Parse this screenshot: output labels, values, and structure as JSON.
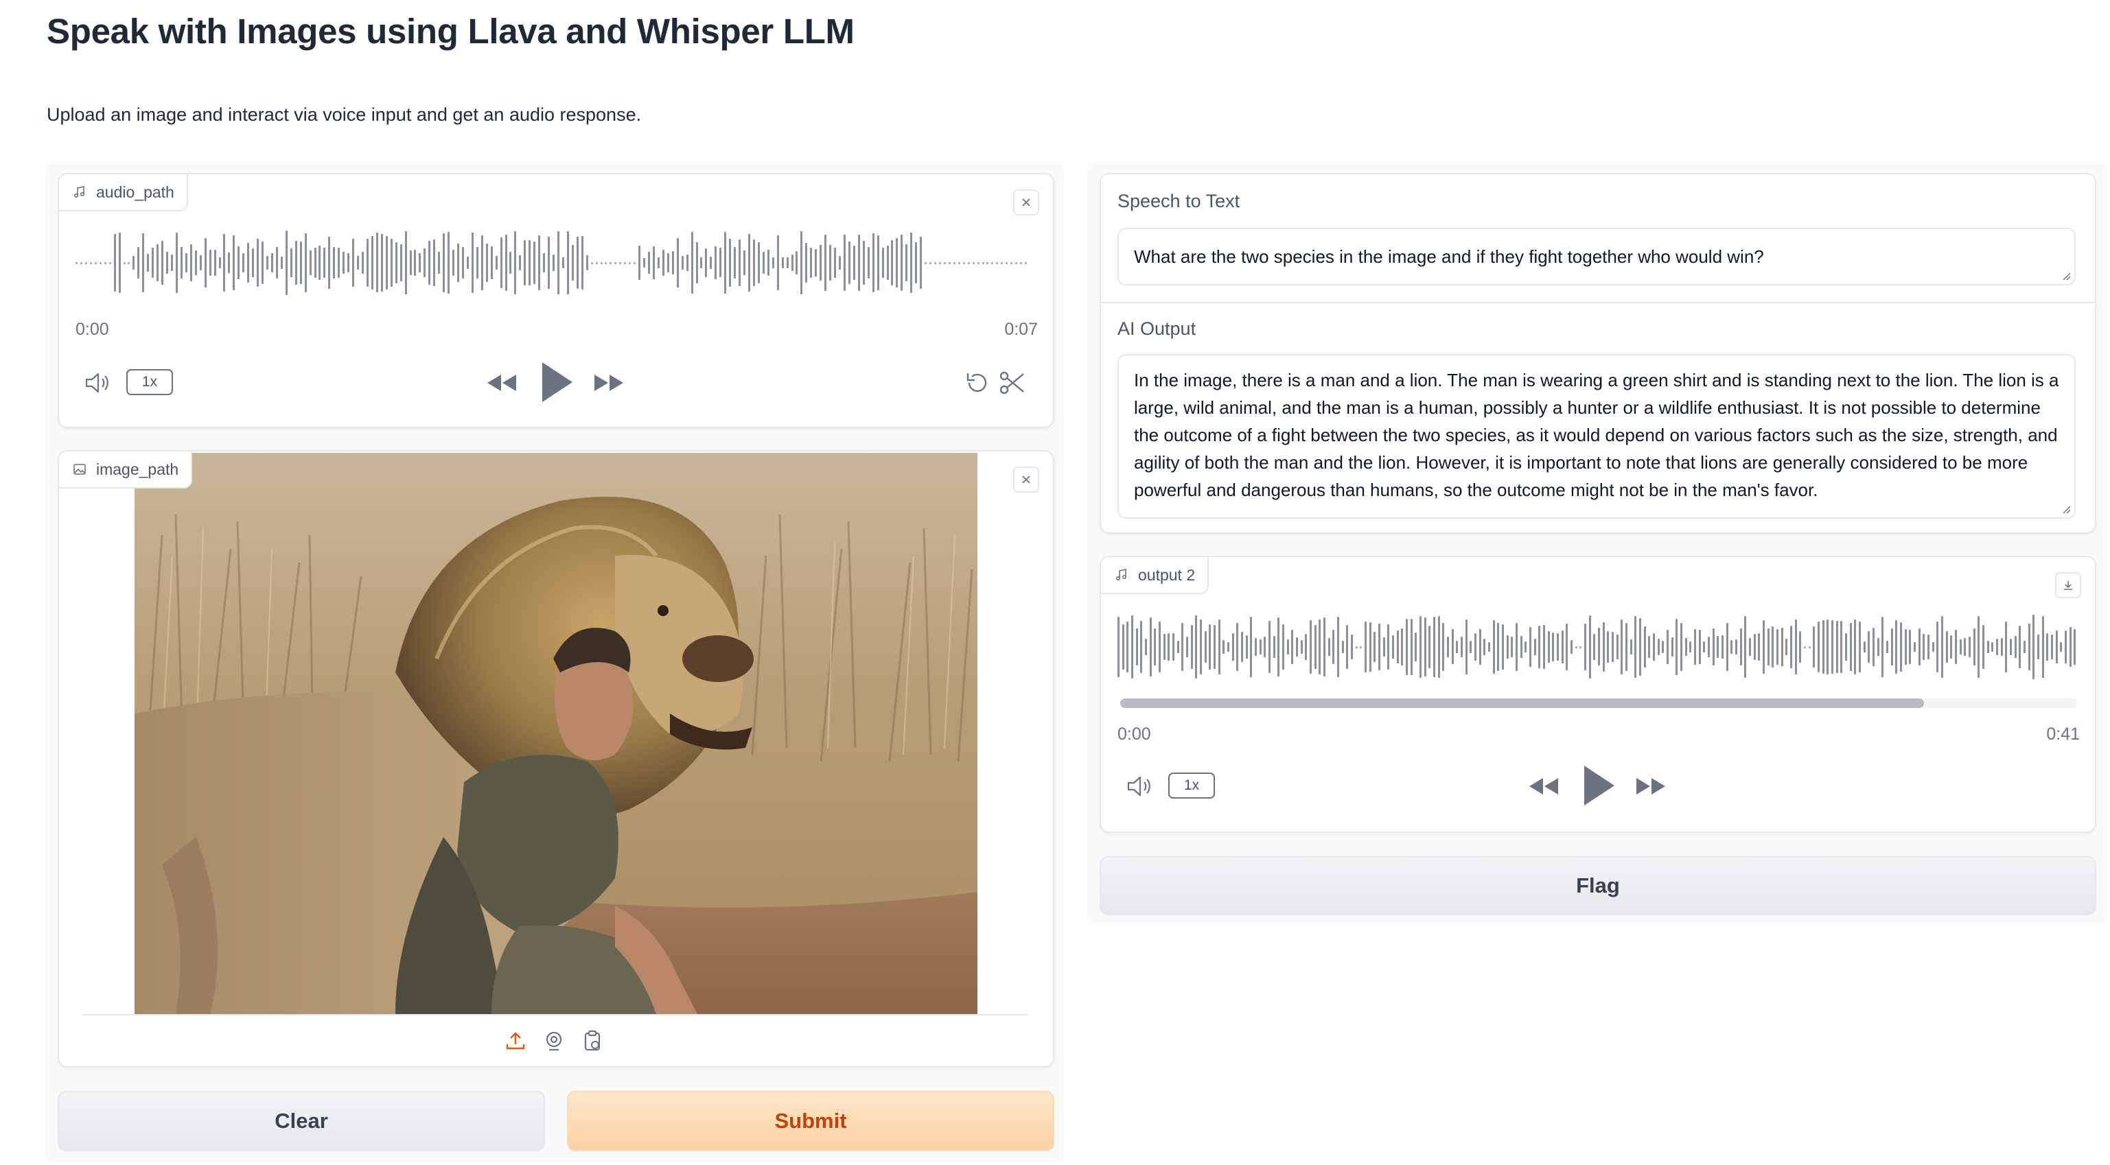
{
  "header": {
    "title": "Speak with Images using Llava and Whisper LLM",
    "description": "Upload an image and interact via voice input and get an audio response."
  },
  "audio_input": {
    "label": "audio_path",
    "time_start": "0:00",
    "time_end": "0:07",
    "speed": "1x",
    "icons": [
      "music-note-icon",
      "close-icon",
      "volume-icon",
      "rewind-icon",
      "play-icon",
      "fast-forward-icon",
      "undo-icon",
      "scissors-icon"
    ]
  },
  "image_input": {
    "label": "image_path",
    "image_alt": "Man crouching next to a lion in dry grass",
    "icons": [
      "image-icon",
      "close-icon",
      "upload-icon",
      "webcam-icon",
      "clipboard-icon"
    ]
  },
  "speech_to_text": {
    "label": "Speech to Text",
    "value": "What are the two species in the image and if they fight together who would win?"
  },
  "ai_output": {
    "label": "AI Output",
    "value": "In the image, there is a man and a lion. The man is wearing a green shirt and is standing next to the lion. The lion is a large, wild animal, and the man is a human, possibly a hunter or a wildlife enthusiast. It is not possible to determine the outcome of a fight between the two species, as it would depend on various factors such as the size, strength, and agility of both the man and the lion. However, it is important to note that lions are generally considered to be more powerful and dangerous than humans, so the outcome might not be in the man's favor."
  },
  "audio_output": {
    "label": "output 2",
    "time_start": "0:00",
    "time_end": "0:41",
    "speed": "1x",
    "progress": 0.84,
    "icons": [
      "music-note-icon",
      "download-icon",
      "volume-icon",
      "rewind-icon",
      "play-icon",
      "fast-forward-icon"
    ]
  },
  "buttons": {
    "clear": "Clear",
    "submit": "Submit",
    "flag": "Flag"
  },
  "colors": {
    "accent": "#ea580c",
    "submit_bg": "#fbd2a1",
    "waveform": "#8a8f98",
    "panel_bg": "#f9fafb"
  }
}
